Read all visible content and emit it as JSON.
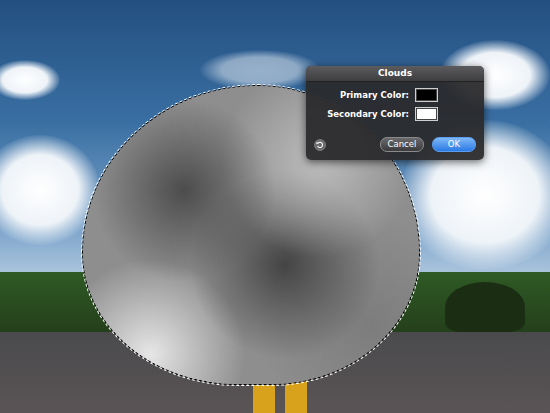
{
  "dialog": {
    "title": "Clouds",
    "fields": [
      {
        "label": "Primary Color:",
        "color": "#000000"
      },
      {
        "label": "Secondary Color:",
        "color": "#ffffff"
      }
    ],
    "buttons": [
      {
        "label": "Cancel",
        "selected": false
      },
      {
        "label": "OK",
        "selected": true
      }
    ]
  }
}
